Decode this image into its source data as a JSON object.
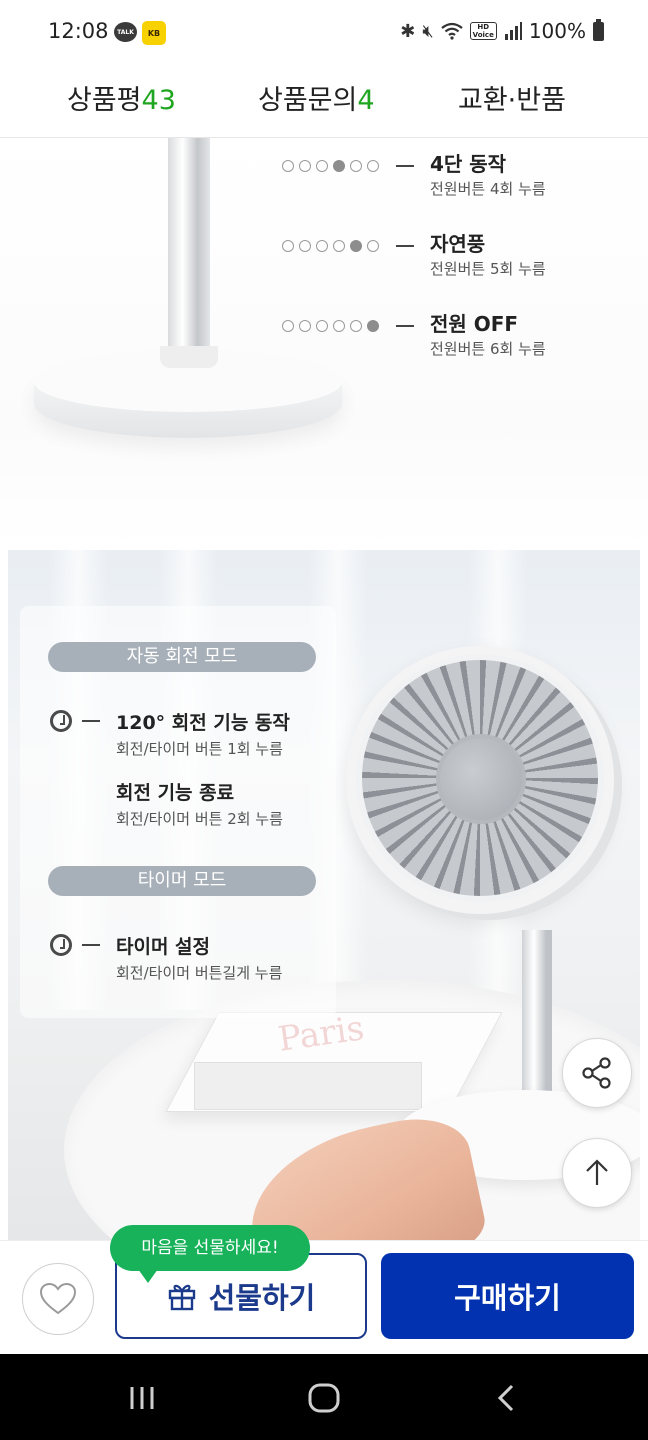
{
  "status_bar": {
    "time": "12:08",
    "talk_badge": "TALK",
    "kakao_badge": "KB",
    "battery": "100%",
    "hd_label": "HD\nVoice",
    "icons": [
      "bluetooth-icon",
      "mute-icon",
      "wifi-icon",
      "hd-voice-icon",
      "signal-icon",
      "battery-icon"
    ]
  },
  "tabs": [
    {
      "label": "상품평",
      "count": "43"
    },
    {
      "label": "상품문의",
      "count": "4"
    },
    {
      "label": "교환·반품",
      "count": ""
    }
  ],
  "mode_list": [
    {
      "active_dot": 4,
      "title": "4단 동작",
      "sub": "전원버튼 4회 누름"
    },
    {
      "active_dot": 5,
      "title": "자연풍",
      "sub": "전원버튼 5회 누름"
    },
    {
      "active_dot": 6,
      "title": "전원 OFF",
      "sub": "전원버튼 6회 누름"
    }
  ],
  "panel": {
    "auto_rotate_title": "자동 회전 모드",
    "feature1_title": "120° 회전 기능 동작",
    "feature1_sub": "회전/타이머 버튼 1회 누름",
    "feature2_title": "회전 기능 종료",
    "feature2_sub": "회전/타이머 버튼 2회 누름",
    "timer_title": "타이머 모드",
    "feature3_title": "타이머 설정",
    "feature3_sub": "회전/타이머 버튼길게 누름"
  },
  "book_text": "Paris",
  "buy_bar": {
    "gift_bubble": "마음을 선물하세요!",
    "gift_label": "선물하기",
    "buy_label": "구매하기"
  },
  "colors": {
    "accent_green": "#1fa51f",
    "buy_blue": "#0232b0",
    "bubble_green": "#17b25a",
    "pill_gray": "#a7b0b9"
  }
}
